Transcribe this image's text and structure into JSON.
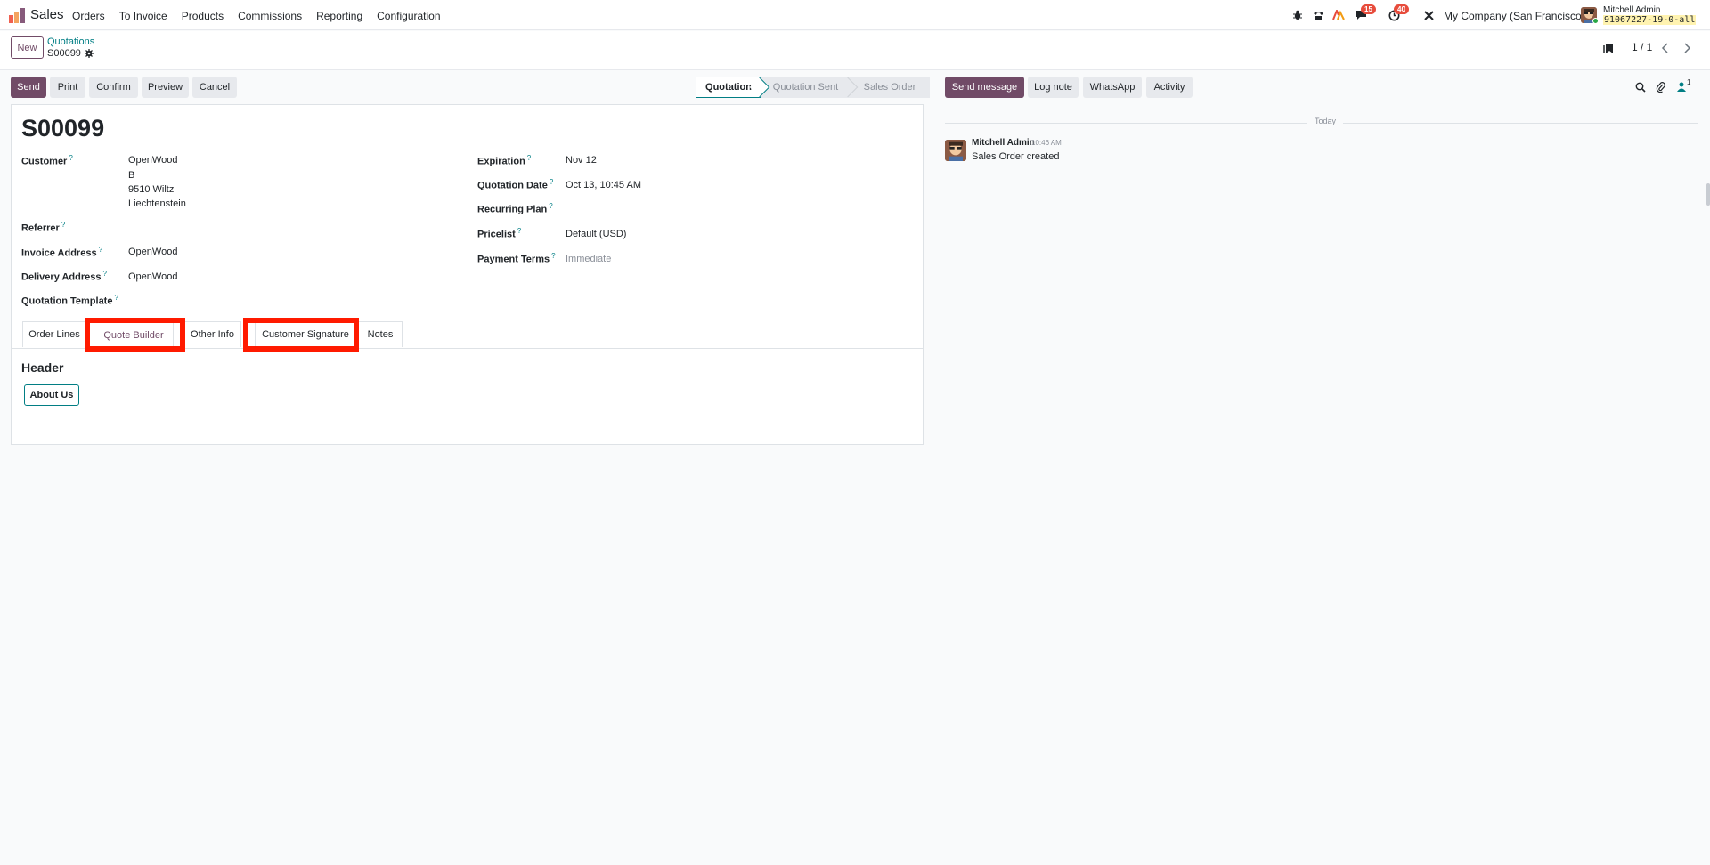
{
  "navbar": {
    "app_name": "Sales",
    "menu": [
      "Orders",
      "To Invoice",
      "Products",
      "Commissions",
      "Reporting",
      "Configuration"
    ],
    "messages_badge": "15",
    "activities_badge": "40",
    "company": "My Company (San Francisco)",
    "user_name": "Mitchell Admin",
    "database": "91067227-19-0-all"
  },
  "control_panel": {
    "new_label": "New",
    "breadcrumb": "Quotations",
    "record": "S00099",
    "pager": "1 / 1"
  },
  "actions": {
    "send": "Send",
    "print": "Print",
    "confirm": "Confirm",
    "preview": "Preview",
    "cancel": "Cancel"
  },
  "status_stages": [
    {
      "label": "Quotation",
      "active": true
    },
    {
      "label": "Quotation Sent",
      "active": false
    },
    {
      "label": "Sales Order",
      "active": false
    }
  ],
  "form": {
    "name": "S00099",
    "customer_label": "Customer",
    "customer_lines": [
      "OpenWood",
      "B",
      "9510 Wiltz",
      "Liechtenstein"
    ],
    "referrer_label": "Referrer",
    "invoice_address_label": "Invoice Address",
    "invoice_address": "OpenWood",
    "delivery_address_label": "Delivery Address",
    "delivery_address": "OpenWood",
    "quotation_template_label": "Quotation Template",
    "expiration_label": "Expiration",
    "expiration": "Nov 12",
    "quotation_date_label": "Quotation Date",
    "quotation_date": "Oct 13, 10:45 AM",
    "recurring_plan_label": "Recurring Plan",
    "pricelist_label": "Pricelist",
    "pricelist": "Default (USD)",
    "payment_terms_label": "Payment Terms",
    "payment_terms_placeholder": "Immediate",
    "help_mark": "?"
  },
  "tabs": [
    {
      "label": "Order Lines",
      "active": false
    },
    {
      "label": "Quote Builder",
      "active": true
    },
    {
      "label": "Other Info",
      "active": false
    },
    {
      "label": "Customer Signature",
      "active": false
    },
    {
      "label": "Notes",
      "active": false
    }
  ],
  "quote_builder": {
    "section_title": "Header",
    "about_us": "About Us"
  },
  "chatter": {
    "send_message": "Send message",
    "log_note": "Log note",
    "whatsapp": "WhatsApp",
    "activity": "Activity",
    "followers_count": "1",
    "date_divider": "Today",
    "message": {
      "author": "Mitchell Admin",
      "time": "10:46 AM",
      "body": "Sales Order created"
    }
  },
  "colors": {
    "brand": "#714b67",
    "teal": "#017e84",
    "highlight": "#ff1a00"
  }
}
